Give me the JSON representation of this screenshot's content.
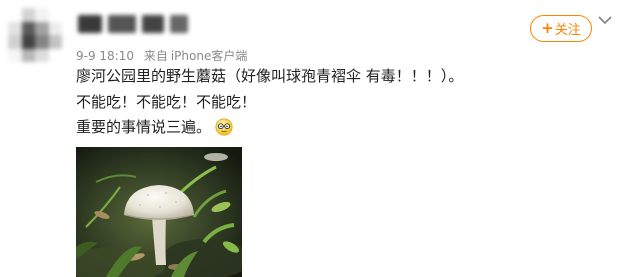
{
  "post": {
    "meta": {
      "date": "9-9 18:10",
      "source_prefix": "来自",
      "source": "iPhone客户端"
    },
    "follow_button": {
      "plus": "+",
      "label": "关注"
    },
    "content": {
      "line1": "廖河公园里的野生蘑菇（好像叫球孢青褶伞 有毒！！！）。",
      "line2": "不能吃！不能吃！不能吃！",
      "line3": "重要的事情说三遍。"
    },
    "icons": {
      "dropdown": "chevron-down-icon",
      "emoji": "emoji-face-icon"
    },
    "colors": {
      "accent": "#ff8200",
      "text": "#222222",
      "meta": "#8a8a8a"
    }
  }
}
